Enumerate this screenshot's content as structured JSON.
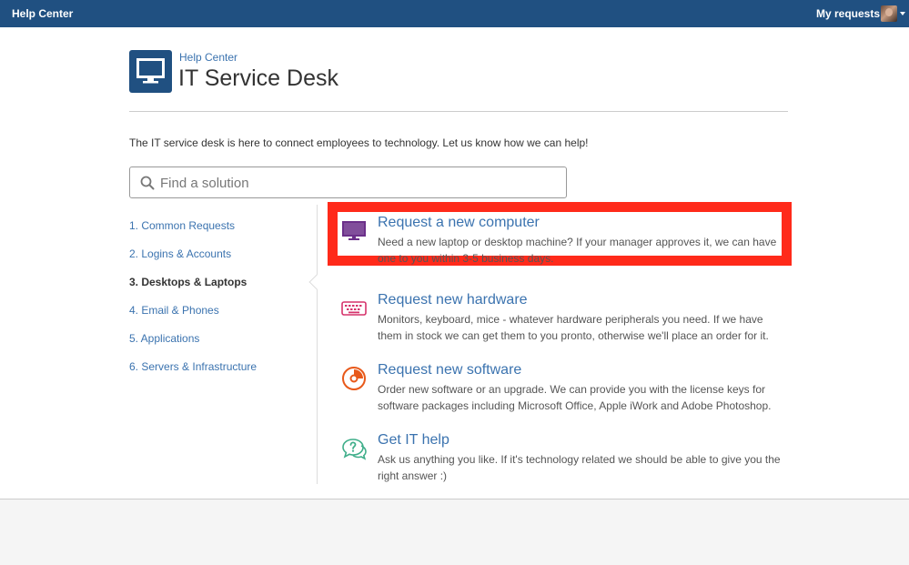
{
  "topbar": {
    "brand": "Help Center",
    "my_requests": "My requests",
    "color": "#205081"
  },
  "header": {
    "breadcrumb": "Help Center",
    "title": "IT Service Desk",
    "logo_icon": "monitor-icon"
  },
  "intro": "The IT service desk is here to connect employees to technology. Let us know how we can help!",
  "search": {
    "placeholder": "Find a solution",
    "value": ""
  },
  "nav": {
    "items": [
      {
        "label": "1. Common Requests",
        "active": false
      },
      {
        "label": "2. Logins & Accounts",
        "active": false
      },
      {
        "label": "3. Desktops & Laptops",
        "active": true
      },
      {
        "label": "4. Email & Phones",
        "active": false
      },
      {
        "label": "5. Applications",
        "active": false
      },
      {
        "label": "6. Servers & Infrastructure",
        "active": false
      }
    ]
  },
  "options": [
    {
      "title": "Request a new computer",
      "description": "Need a new laptop or desktop machine? If your manager approves it, we can have one to you within 3-5 business days.",
      "icon": "monitor-icon",
      "icon_color": "#6b2f8a",
      "highlighted": true
    },
    {
      "title": "Request new hardware",
      "description": "Monitors, keyboard, mice - whatever hardware peripherals you need. If we have them in stock we can get them to you pronto, otherwise we'll place an order for it.",
      "icon": "keyboard-icon",
      "icon_color": "#d6336c",
      "highlighted": false
    },
    {
      "title": "Request new software",
      "description": "Order new software or an upgrade. We can provide you with the license keys for software packages including Microsoft Office, Apple iWork and Adobe Photoshop.",
      "icon": "disc-icon",
      "icon_color": "#e8591a",
      "highlighted": false
    },
    {
      "title": "Get IT help",
      "description": "Ask us anything you like. If it's technology related we should be able to give you the right answer :)",
      "icon": "chat-question-icon",
      "icon_color": "#3fae8a",
      "highlighted": false
    }
  ],
  "colors": {
    "link": "#3b73af",
    "highlight_border": "#ff2a1a"
  }
}
